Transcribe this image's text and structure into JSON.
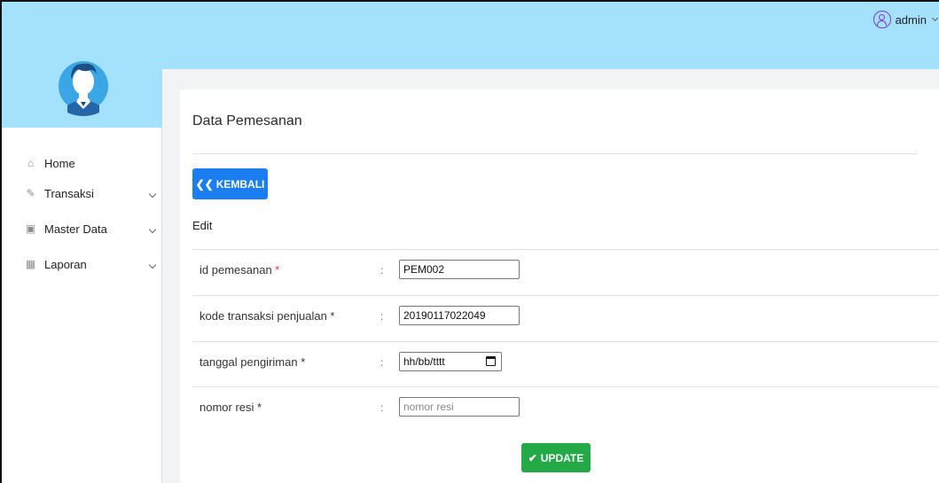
{
  "header": {
    "username": "admin"
  },
  "sidebar": {
    "items": [
      {
        "label": "Home",
        "icon": "home-icon"
      },
      {
        "label": "Transaksi",
        "icon": "pencil-icon"
      },
      {
        "label": "Master Data",
        "icon": "edit-icon"
      },
      {
        "label": "Laporan",
        "icon": "calendar-icon"
      }
    ]
  },
  "main": {
    "title": "Data Pemesanan",
    "back_button": "KEMBALI",
    "section_label": "Edit",
    "fields": [
      {
        "label": "id pemesanan",
        "required": "*",
        "value": "PEM002",
        "placeholder": ""
      },
      {
        "label": "kode transaksi penjualan *",
        "value": "20190117022049",
        "placeholder": ""
      },
      {
        "label": "tanggal pengiriman *",
        "value": "hh/bb/tttt",
        "placeholder": ""
      },
      {
        "label": "nomor resi *",
        "value": "",
        "placeholder": "nomor resi"
      }
    ],
    "colon": ":",
    "update_button": "UPDATE"
  },
  "colors": {
    "header_bg": "#a3e1fc",
    "primary_button": "#1a7ef0",
    "success_button": "#23a945",
    "required_star": "#e53935"
  }
}
